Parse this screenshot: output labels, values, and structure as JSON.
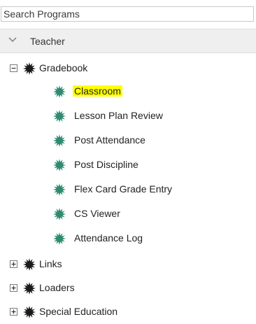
{
  "search": {
    "placeholder": "Search Programs"
  },
  "section": {
    "title": "Teacher",
    "chevron_icon": "chevron-down-icon"
  },
  "tree": {
    "gradebook": {
      "label": "Gradebook",
      "expanded": true,
      "toggle_icon": "collapse-minus-icon",
      "items": [
        {
          "label": "Classroom",
          "highlighted": true
        },
        {
          "label": "Lesson Plan Review"
        },
        {
          "label": "Post Attendance"
        },
        {
          "label": "Post Discipline"
        },
        {
          "label": "Flex Card Grade Entry"
        },
        {
          "label": "CS Viewer"
        },
        {
          "label": "Attendance Log"
        }
      ]
    },
    "folders": [
      {
        "label": "Links",
        "expanded": false,
        "toggle_icon": "expand-plus-icon"
      },
      {
        "label": "Loaders",
        "expanded": false,
        "toggle_icon": "expand-plus-icon"
      },
      {
        "label": "Special Education",
        "expanded": false,
        "toggle_icon": "expand-plus-icon"
      }
    ]
  },
  "colors": {
    "highlight": "#ffff00",
    "folder_gear": "#1a1a1a",
    "program_gear": "#2e8b70",
    "header_bg": "#efefef"
  }
}
